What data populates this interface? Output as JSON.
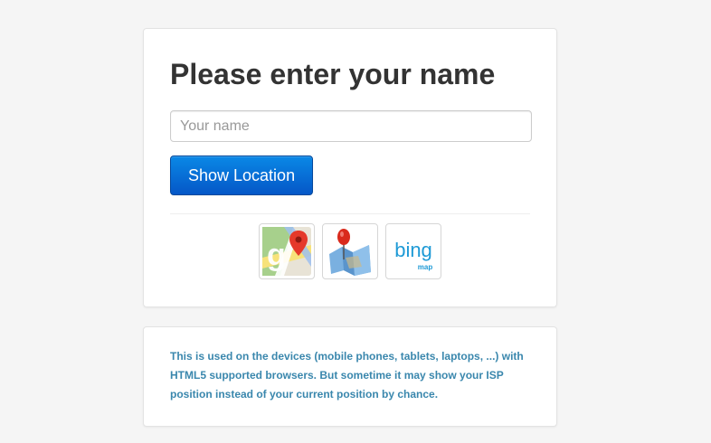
{
  "form": {
    "title": "Please enter your name",
    "name_placeholder": "Your name",
    "name_value": "",
    "submit_label": "Show Location"
  },
  "map_providers": [
    {
      "name": "Google Maps",
      "icon": "google-maps-icon"
    },
    {
      "name": "Map",
      "icon": "map-pin-icon",
      "label": "Map"
    },
    {
      "name": "Bing Map",
      "icon": "bing-map-icon",
      "logo_text": "bing",
      "sub_label": "map"
    }
  ],
  "note": {
    "text": "This is used on the devices (mobile phones, tablets, laptops, ...) with HTML5 supported browsers. But sometime it may show your ISP position instead of your current position by chance."
  },
  "colors": {
    "page_background": "#f5f5f5",
    "button_top": "#0a88e6",
    "button_bottom": "#0557c7",
    "note_text": "#3a87ad",
    "title_text": "#333333"
  }
}
